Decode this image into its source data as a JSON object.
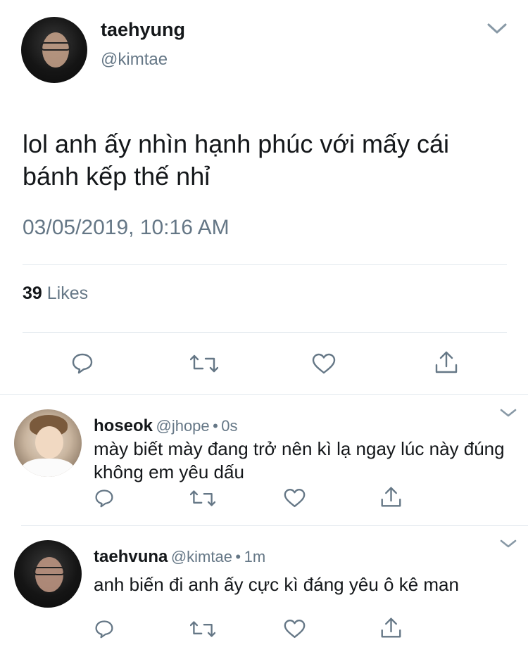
{
  "main_tweet": {
    "author_name": "taehyung",
    "author_handle": "@kimtae",
    "text": "lol anh ấy nhìn hạnh phúc với mấy cái bánh kếp thế nhỉ",
    "timestamp": "03/05/2019, 10:16 AM",
    "likes_count": "39",
    "likes_label": "Likes",
    "menu_icon": "chevron-down-icon",
    "actions": [
      "reply-icon",
      "retweet-icon",
      "like-icon",
      "share-icon"
    ]
  },
  "replies": [
    {
      "author_name": "hoseok",
      "author_handle": "@jhope",
      "separator": "•",
      "time": "0s",
      "text": "mày biết mày đang trở nên kì lạ ngay lúc này đúng không em yêu dấu"
    },
    {
      "author_name": "taehvuna",
      "author_handle": "@kimtae",
      "separator": "•",
      "time": "1m",
      "text": "anh biến đi anh ấy cực kì đáng yêu ô kê man"
    }
  ],
  "colors": {
    "text": "#14171a",
    "secondary": "#657786",
    "divider": "#e1e8ed",
    "icon": "#657786"
  }
}
